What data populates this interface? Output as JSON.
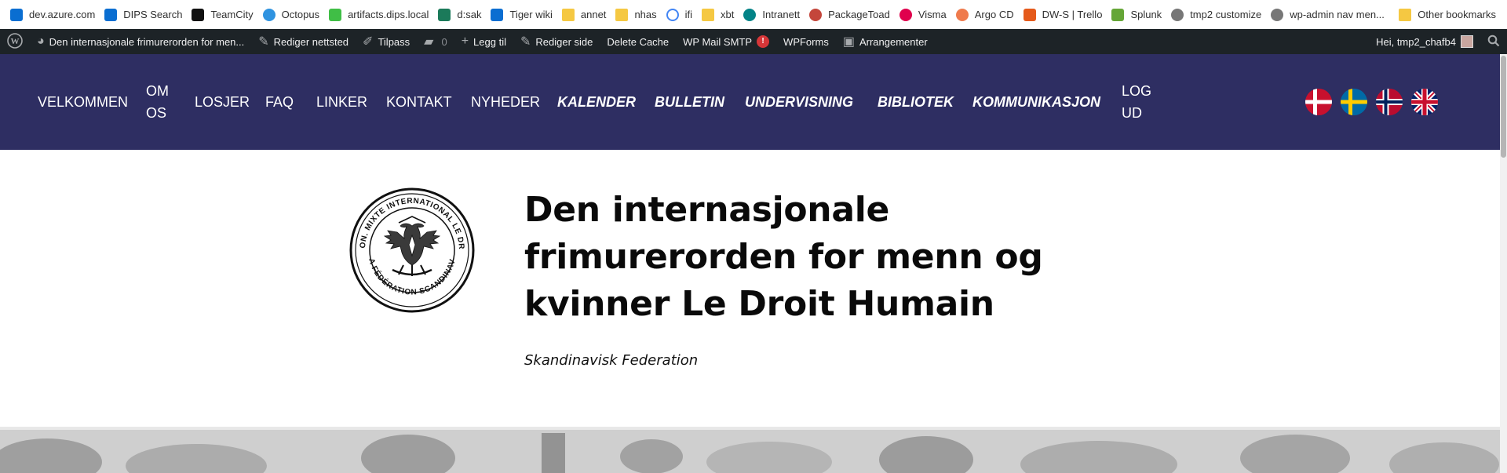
{
  "bookmarks": {
    "items": [
      {
        "label": "dev.azure.com",
        "icon": "azure-devops-icon"
      },
      {
        "label": "DIPS Search",
        "icon": "azure-devops-icon"
      },
      {
        "label": "TeamCity",
        "icon": "teamcity-icon"
      },
      {
        "label": "Octopus",
        "icon": "octopus-icon"
      },
      {
        "label": "artifacts.dips.local",
        "icon": "artifacts-icon"
      },
      {
        "label": "d:sak",
        "icon": "dsak-icon"
      },
      {
        "label": "Tiger wiki",
        "icon": "azure-devops-icon"
      },
      {
        "label": "annet",
        "icon": "folder-icon"
      },
      {
        "label": "nhas",
        "icon": "folder-icon"
      },
      {
        "label": "ifi",
        "icon": "google-icon"
      },
      {
        "label": "xbt",
        "icon": "folder-icon"
      },
      {
        "label": "Intranett",
        "icon": "sharepoint-icon"
      },
      {
        "label": "PackageToad",
        "icon": "packagetoad-icon"
      },
      {
        "label": "Visma",
        "icon": "visma-icon"
      },
      {
        "label": "Argo CD",
        "icon": "argo-icon"
      },
      {
        "label": "DW-S | Trello",
        "icon": "trello-icon"
      },
      {
        "label": "Splunk",
        "icon": "splunk-icon"
      },
      {
        "label": "tmp2 customize",
        "icon": "globe-icon"
      },
      {
        "label": "wp-admin nav men...",
        "icon": "globe-icon"
      }
    ],
    "other": "Other bookmarks"
  },
  "adminbar": {
    "site_name": "Den internasjonale frimurerorden for men...",
    "edit_site": "Rediger nettsted",
    "customize": "Tilpass",
    "comments_count": "0",
    "add_new": "Legg til",
    "edit_page": "Rediger side",
    "delete_cache": "Delete Cache",
    "wp_mail_smtp": "WP Mail SMTP",
    "smtp_badge": "!",
    "wpforms": "WPForms",
    "events": "Arrangementer",
    "greeting": "Hei, tmp2_chafb4"
  },
  "nav": {
    "velkommen": "VELKOMMEN",
    "om_os": "OM OS",
    "losjer": "LOSJER",
    "faq": "FAQ",
    "linker": "LINKER",
    "kontakt": "KONTAKT",
    "nyheder": "NYHEDER",
    "kalender": "KALENDER",
    "bulletin": "BULLETIN",
    "undervisning": "UNDERVISNING",
    "bibliotek": "BIBLIOTEK",
    "kommunikasjon": "KOMMUNIKASJON",
    "log_ud": "LOG UD"
  },
  "colors": {
    "nav_background": "#2e2e62",
    "admin_bar": "#1d2327"
  },
  "header": {
    "title": "Den internasjonale frimurerorden for menn og kvinner Le Droit Humain",
    "tagline": "Skandinavisk Federation",
    "logo_text_top": "ORDRE MAÇON. MIXTE INTERNATIONAL LE DROIT HUMAIN",
    "logo_text_bottom": "LA FÉDÉRATION SCANDINAVE"
  }
}
